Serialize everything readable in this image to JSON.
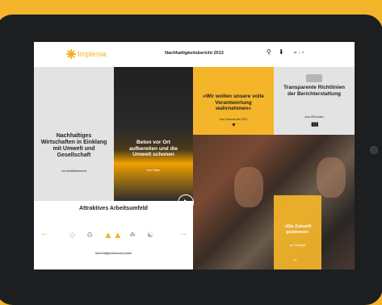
{
  "header": {
    "logo_text": "Implenia",
    "title": "Nachhaltigkeitsbericht 2013",
    "lang_de": "de",
    "lang_fr": "fr",
    "search_icon": "search-icon",
    "download_icon": "download-icon"
  },
  "tiles": {
    "sustainable": {
      "heading": "Nachhaltiges Wirtschaften in Einklang mit Umwelt und Gesellschaft",
      "link": "zur Inhaltsübersicht"
    },
    "concrete": {
      "heading": "Beton vor Ort aufbereiten und die Umwelt schonen",
      "link": "zum Video"
    },
    "quote": {
      "heading": "«Wir wollen unsere volle Verantwortung wahrnehmen»",
      "link": "zum Vorwort des CEO"
    },
    "reporting": {
      "heading": "Transparente Richtlinien der Berichterstattung",
      "link": "zum GRI-Index"
    },
    "future": {
      "heading": "«Die Zukunft gewinnen»",
      "link": "zur Strategie"
    },
    "workplace": {
      "heading": "Attraktives Arbeitsumfeld",
      "link": "Nachhaltigkeitsschwerpunkte"
    }
  },
  "colors": {
    "brand": "#f5b52a",
    "dark": "#1d1e20"
  }
}
